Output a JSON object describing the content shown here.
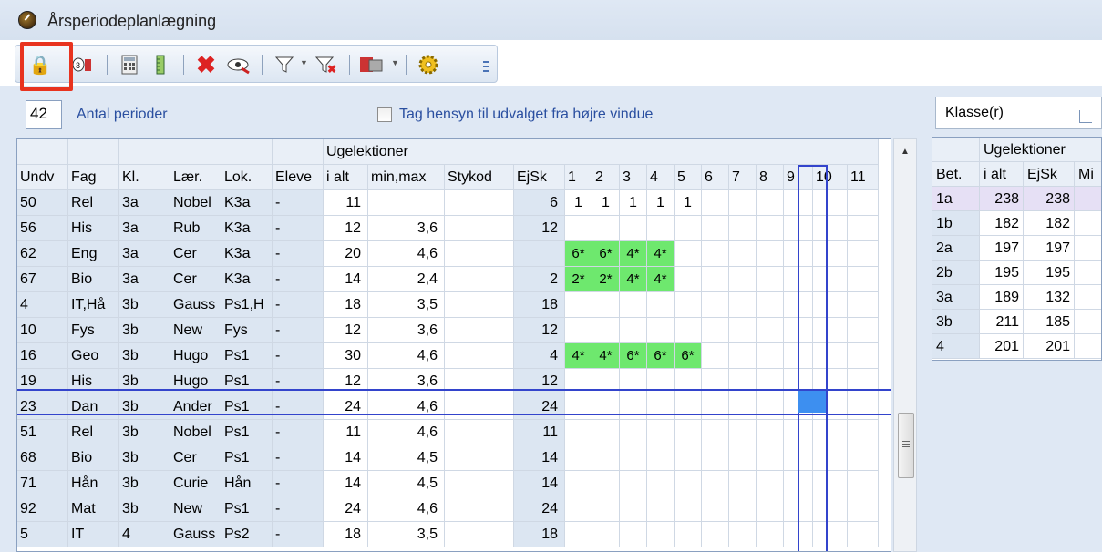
{
  "window": {
    "title": "Årsperiodeplanlægning"
  },
  "periods": {
    "value": "42",
    "label": "Antal perioder"
  },
  "filter": {
    "checkbox_label": "Tag hensyn til udvalget fra højre vindue"
  },
  "grid": {
    "group_header": "Ugelektioner",
    "columns": [
      "Undv",
      "Fag",
      "Kl.",
      "Lær.",
      "Lok.",
      "Eleve",
      "i alt",
      "min,max",
      "Stykod",
      "EjSk",
      "1",
      "2",
      "3",
      "4",
      "5",
      "6",
      "7",
      "8",
      "9",
      "10",
      "11"
    ],
    "rows": [
      {
        "undv": "50",
        "fag": "Rel",
        "kl": "3a",
        "laer": "Nobel",
        "lok": "K3a",
        "elev": "-",
        "ialt": "11",
        "minmax": "",
        "stykod": "",
        "ejsk": "6",
        "p": [
          "1",
          "1",
          "1",
          "1",
          "1",
          "",
          "",
          "",
          "",
          "",
          ""
        ]
      },
      {
        "undv": "56",
        "fag": "His",
        "kl": "3a",
        "laer": "Rub",
        "lok": "K3a",
        "elev": "-",
        "ialt": "12",
        "minmax": "3,6",
        "stykod": "",
        "ejsk": "12",
        "p": [
          "",
          "",
          "",
          "",
          "",
          "",
          "",
          "",
          "",
          "",
          ""
        ]
      },
      {
        "undv": "62",
        "fag": "Eng",
        "kl": "3a",
        "laer": "Cer",
        "lok": "K3a",
        "elev": "-",
        "ialt": "20",
        "minmax": "4,6",
        "stykod": "",
        "ejsk": "",
        "p": [
          "6*",
          "6*",
          "4*",
          "4*",
          "",
          "",
          "",
          "",
          "",
          "",
          ""
        ]
      },
      {
        "undv": "67",
        "fag": "Bio",
        "kl": "3a",
        "laer": "Cer",
        "lok": "K3a",
        "elev": "-",
        "ialt": "14",
        "minmax": "2,4",
        "stykod": "",
        "ejsk": "2",
        "p": [
          "2*",
          "2*",
          "4*",
          "4*",
          "",
          "",
          "",
          "",
          "",
          "",
          ""
        ]
      },
      {
        "undv": "4",
        "fag": "IT,Hå",
        "kl": "3b",
        "laer": "Gauss",
        "lok": "Ps1,H",
        "elev": "-",
        "ialt": "18",
        "minmax": "3,5",
        "stykod": "",
        "ejsk": "18",
        "p": [
          "",
          "",
          "",
          "",
          "",
          "",
          "",
          "",
          "",
          "",
          ""
        ]
      },
      {
        "undv": "10",
        "fag": "Fys",
        "kl": "3b",
        "laer": "New",
        "lok": "Fys",
        "elev": "-",
        "ialt": "12",
        "minmax": "3,6",
        "stykod": "",
        "ejsk": "12",
        "p": [
          "",
          "",
          "",
          "",
          "",
          "",
          "",
          "",
          "",
          "",
          ""
        ]
      },
      {
        "undv": "16",
        "fag": "Geo",
        "kl": "3b",
        "laer": "Hugo",
        "lok": "Ps1",
        "elev": "-",
        "ialt": "30",
        "minmax": "4,6",
        "stykod": "",
        "ejsk": "4",
        "p": [
          "4*",
          "4*",
          "6*",
          "6*",
          "6*",
          "",
          "",
          "",
          "",
          "",
          ""
        ]
      },
      {
        "undv": "19",
        "fag": "His",
        "kl": "3b",
        "laer": "Hugo",
        "lok": "Ps1",
        "elev": "-",
        "ialt": "12",
        "minmax": "3,6",
        "stykod": "",
        "ejsk": "12",
        "p": [
          "",
          "",
          "",
          "",
          "",
          "",
          "",
          "",
          "",
          "",
          ""
        ]
      },
      {
        "undv": "23",
        "fag": "Dan",
        "kl": "3b",
        "laer": "Ander",
        "lok": "Ps1",
        "elev": "-",
        "ialt": "24",
        "minmax": "4,6",
        "stykod": "",
        "ejsk": "24",
        "p": [
          "",
          "",
          "",
          "",
          "",
          "",
          "",
          "",
          "",
          "",
          ""
        ]
      },
      {
        "undv": "51",
        "fag": "Rel",
        "kl": "3b",
        "laer": "Nobel",
        "lok": "Ps1",
        "elev": "-",
        "ialt": "11",
        "minmax": "4,6",
        "stykod": "",
        "ejsk": "11",
        "p": [
          "",
          "",
          "",
          "",
          "",
          "",
          "",
          "",
          "",
          "",
          ""
        ]
      },
      {
        "undv": "68",
        "fag": "Bio",
        "kl": "3b",
        "laer": "Cer",
        "lok": "Ps1",
        "elev": "-",
        "ialt": "14",
        "minmax": "4,5",
        "stykod": "",
        "ejsk": "14",
        "p": [
          "",
          "",
          "",
          "",
          "",
          "",
          "",
          "",
          "",
          "",
          ""
        ]
      },
      {
        "undv": "71",
        "fag": "Hån",
        "kl": "3b",
        "laer": "Curie",
        "lok": "Hån",
        "elev": "-",
        "ialt": "14",
        "minmax": "4,5",
        "stykod": "",
        "ejsk": "14",
        "p": [
          "",
          "",
          "",
          "",
          "",
          "",
          "",
          "",
          "",
          "",
          ""
        ]
      },
      {
        "undv": "92",
        "fag": "Mat",
        "kl": "3b",
        "laer": "New",
        "lok": "Ps1",
        "elev": "-",
        "ialt": "24",
        "minmax": "4,6",
        "stykod": "",
        "ejsk": "24",
        "p": [
          "",
          "",
          "",
          "",
          "",
          "",
          "",
          "",
          "",
          "",
          ""
        ]
      },
      {
        "undv": "5",
        "fag": "IT",
        "kl": "4",
        "laer": "Gauss",
        "lok": "Ps2",
        "elev": "-",
        "ialt": "18",
        "minmax": "3,5",
        "stykod": "",
        "ejsk": "18",
        "p": [
          "",
          "",
          "",
          "",
          "",
          "",
          "",
          "",
          "",
          "",
          ""
        ]
      }
    ]
  },
  "right_panel": {
    "select_value": "Klasse(r)",
    "group_header": "Ugelektioner",
    "columns": [
      "Bet.",
      "i alt",
      "EjSk",
      "Mi"
    ],
    "rows": [
      {
        "bet": "1a",
        "ialt": "238",
        "ejsk": "238"
      },
      {
        "bet": "1b",
        "ialt": "182",
        "ejsk": "182"
      },
      {
        "bet": "2a",
        "ialt": "197",
        "ejsk": "197"
      },
      {
        "bet": "2b",
        "ialt": "195",
        "ejsk": "195"
      },
      {
        "bet": "3a",
        "ialt": "189",
        "ejsk": "132"
      },
      {
        "bet": "3b",
        "ialt": "211",
        "ejsk": "185"
      },
      {
        "bet": "4",
        "ialt": "201",
        "ejsk": "201"
      }
    ]
  },
  "colors": {
    "accent": "#3344cc",
    "highlight": "#e8331f",
    "fixed_cell": "#6ee86e",
    "selected_cell": "#3d8ff0"
  }
}
